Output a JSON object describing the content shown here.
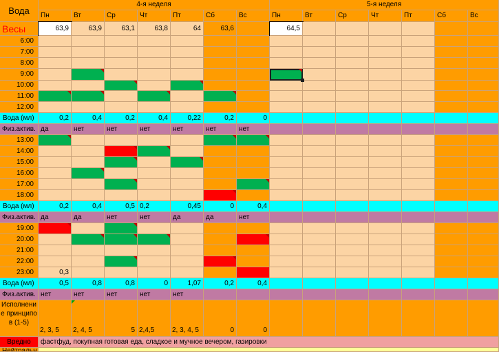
{
  "title": "Вода",
  "weight_label": "Весы",
  "week_titles": [
    "4-я неделя",
    "5-я неделя"
  ],
  "day_labels": [
    "Пн",
    "Вт",
    "Ср",
    "Чт",
    "Пт",
    "Сб",
    "Вс",
    "Пн",
    "Вт",
    "Ср",
    "Чт",
    "Пт",
    "Сб",
    "Вс"
  ],
  "weights": [
    "63,9",
    "63,9",
    "63,1",
    "63,8",
    "64",
    "63,6",
    "",
    "64,5",
    "",
    "",
    "",
    "",
    "",
    ""
  ],
  "row_labels": {
    "water": "Вода (мл)",
    "activity": "Физ.актив.",
    "fulfillment": "Исполнение принципов (1-5)",
    "harmful": "Вредно",
    "neutral": "Нейтральн"
  },
  "times_block1": [
    "6:00",
    "7:00",
    "8:00",
    "9:00",
    "10:00",
    "11:00",
    "12:00"
  ],
  "times_block2": [
    "13:00",
    "14:00",
    "15:00",
    "16:00",
    "17:00",
    "18:00"
  ],
  "times_block3": [
    "19:00",
    "20:00",
    "21:00",
    "22:00",
    "23:00"
  ],
  "water1": [
    "0,2",
    "0,4",
    "0,2",
    "0,4",
    "0,22",
    "0,2",
    "0"
  ],
  "activity1": [
    "да",
    "нет",
    "нет",
    "нет",
    "нет",
    "нет",
    "нет"
  ],
  "water2": [
    "0,2",
    "0,4",
    "0,5",
    "0,2",
    "0,45",
    "0",
    "0,4"
  ],
  "activity2": [
    "да",
    "да",
    "нет",
    "нет",
    "да",
    "да",
    "нет"
  ],
  "water3": [
    "0,5",
    "0,8",
    "0,8",
    "0",
    "1,07",
    "0,2",
    "0,4"
  ],
  "activity3": [
    "нет",
    "нет",
    "нет",
    "нет",
    "нет",
    "",
    ""
  ],
  "note_23": "0,3",
  "fulfillment": [
    "2, 3, 5",
    "2, 4, 5",
    "5",
    "2,4,5",
    "2, 3, 4, 5",
    "0",
    "0"
  ],
  "harmful_text": "фастфуд, покупная готовая еда, сладкое и мучное вечером, газировки",
  "colors": {
    "peach": "#fcd4a4",
    "orange": "#ff9c00",
    "cyan": "#00ffff",
    "purple": "#c07aa3",
    "green": "#00b050",
    "red": "#ff0000",
    "title_red": "#ff0000"
  }
}
